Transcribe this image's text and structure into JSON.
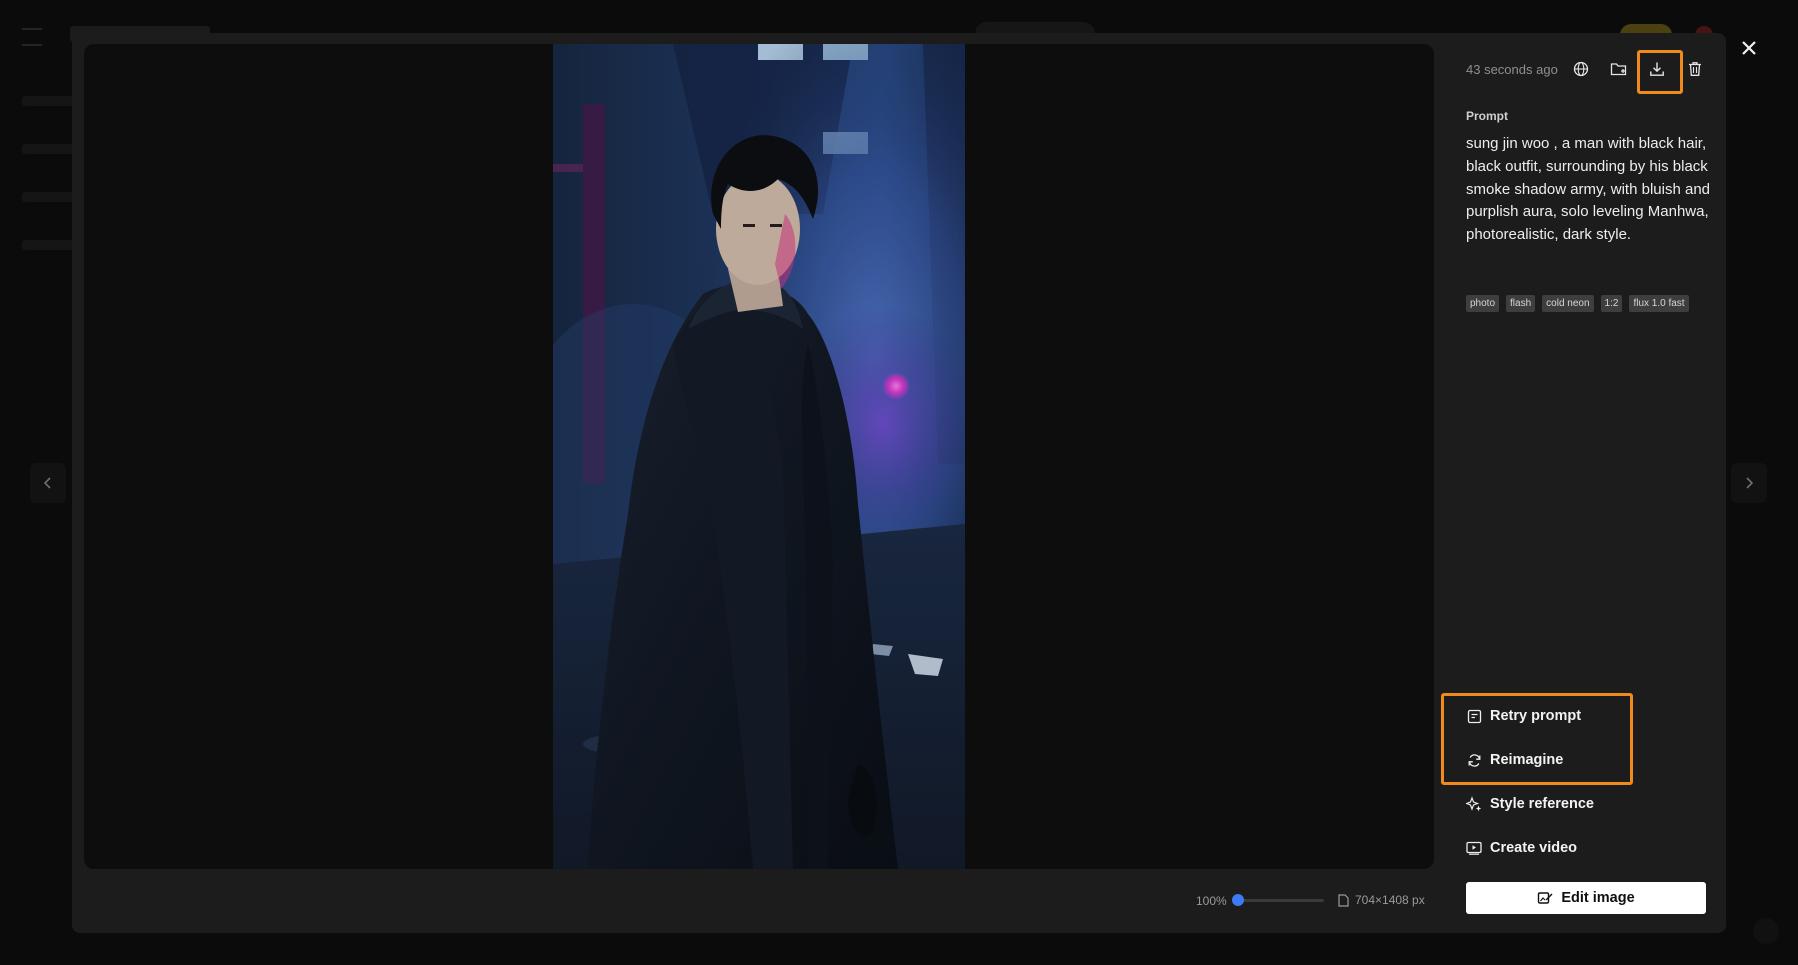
{
  "panel": {
    "timestamp": "43 seconds ago",
    "prompt_label": "Prompt",
    "prompt_text": "sung jin woo , a man with black hair, black outfit, surrounding by his black smoke shadow army, with bluish and purplish aura, solo leveling Manhwa, photorealistic, dark style.",
    "tags": [
      "photo",
      "flash",
      "cold neon",
      "1:2",
      "flux 1.0 fast"
    ],
    "tools": [
      "globe-icon",
      "folder-add-icon",
      "download-icon",
      "trash-icon"
    ]
  },
  "actions": {
    "retry": "Retry prompt",
    "reimagine": "Reimagine",
    "style_reference": "Style reference",
    "create_video": "Create video",
    "edit_image": "Edit image"
  },
  "viewer": {
    "zoom_label": "100%",
    "zoom_level": 0.0,
    "dimensions": "704×1408 px"
  },
  "colors": {
    "highlight": "#f08a1c",
    "accent": "#3d7bf5",
    "panel_bg": "#1c1c1d"
  }
}
